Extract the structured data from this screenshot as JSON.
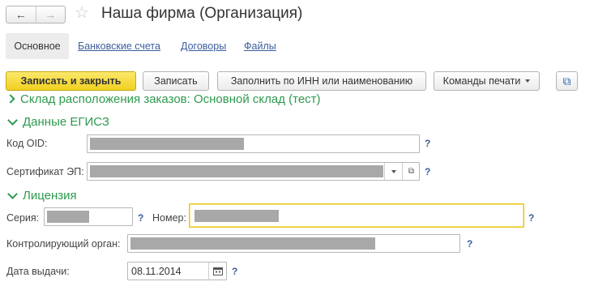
{
  "window": {
    "title": "Наша фирма (Организация)",
    "nav": {
      "back_icon": "←",
      "forward_icon": "→"
    },
    "star_icon": "☆"
  },
  "tabs": [
    {
      "label": "Основное",
      "active": true
    },
    {
      "label": "Банковские счета",
      "active": false
    },
    {
      "label": "Договоры",
      "active": false
    },
    {
      "label": "Файлы",
      "active": false
    }
  ],
  "toolbar": {
    "save_close_label": "Записать и закрыть",
    "save_label": "Записать",
    "fill_label": "Заполнить по ИНН или наименованию",
    "print_label": "Команды печати",
    "copy_icon": "⧉"
  },
  "sections": {
    "warehouse": "Склад расположения заказов: Основной склад (тест)",
    "egisz": "Данные ЕГИСЗ",
    "license": "Лицензия"
  },
  "fields": {
    "oid_label": "Код OID:",
    "cert_label": "Сертификат ЭП:",
    "series_label": "Серия:",
    "number_label": "Номер:",
    "authority_label": "Контролирующий орган:",
    "issue_date_label": "Дата выдачи:",
    "issue_date_value": "08.11.2014"
  },
  "help_mark": "?",
  "accent_colors": {
    "section_green": "#2e9a4e",
    "link_blue": "#3c5e9c",
    "primary_yellow": "#f0d020"
  }
}
